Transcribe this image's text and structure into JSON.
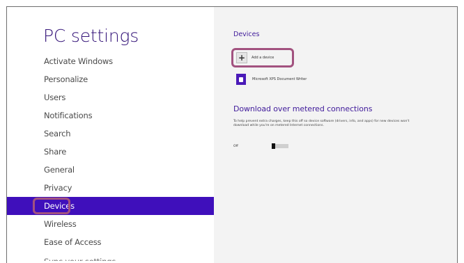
{
  "sidebar": {
    "title": "PC settings",
    "items": [
      {
        "label": "Activate Windows"
      },
      {
        "label": "Personalize"
      },
      {
        "label": "Users"
      },
      {
        "label": "Notifications"
      },
      {
        "label": "Search"
      },
      {
        "label": "Share"
      },
      {
        "label": "General"
      },
      {
        "label": "Privacy"
      },
      {
        "label": "Devices",
        "selected": true
      },
      {
        "label": "Wireless"
      },
      {
        "label": "Ease of Access"
      },
      {
        "label": "Sync your settings"
      }
    ]
  },
  "main": {
    "devices_heading": "Devices",
    "add_device_label": "Add a device",
    "devices": [
      {
        "name": "Microsoft XPS Document Writer",
        "icon": "printer-icon"
      }
    ],
    "metered": {
      "heading": "Download over metered connections",
      "description": "To help prevent extra charges, keep this off so device software (drivers, info, and apps) for new devices won't download while you're on metered Internet connections.",
      "toggle_state": "Off",
      "toggle_on": false
    }
  },
  "colors": {
    "accent": "#3f0fbb",
    "heading": "#3f1a9a",
    "callout": "#a2527f",
    "main_bg": "#f3f3f3"
  }
}
